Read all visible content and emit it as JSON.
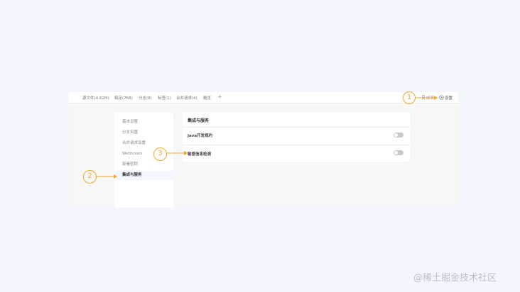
{
  "tabs": [
    {
      "label": "源文件(4.62M)"
    },
    {
      "label": "稿定(768)"
    },
    {
      "label": "分支(8)"
    },
    {
      "label": "标签(1)"
    },
    {
      "label": "合并请求(4)"
    },
    {
      "label": "概览"
    }
  ],
  "tab_add_symbol": "+",
  "header": {
    "members_label": "成员",
    "settings_label": "设置"
  },
  "sidebar": {
    "items": [
      {
        "label": "基本设置",
        "active": false
      },
      {
        "label": "分支设置",
        "active": false
      },
      {
        "label": "合并请求设置",
        "active": false
      },
      {
        "label": "Webhooks",
        "active": false
      },
      {
        "label": "部署密钥",
        "active": false
      },
      {
        "label": "集成与服务",
        "active": true
      }
    ]
  },
  "content": {
    "title": "集成与服务",
    "rows": [
      {
        "label": "Java开发规约",
        "enabled": false
      },
      {
        "label": "敏感信息检测",
        "enabled": false
      }
    ]
  },
  "annotations": [
    {
      "number": "1"
    },
    {
      "number": "2"
    },
    {
      "number": "3"
    }
  ],
  "watermark": "@稀土掘金技术社区",
  "colors": {
    "page_background": "#f3f7fd",
    "annotation": "#f0a82a",
    "toggle_off": "#c8c8c8",
    "active_nav_background": "#f3f7ff"
  },
  "icons": {
    "members": "members-icon",
    "settings": "gear-icon"
  }
}
